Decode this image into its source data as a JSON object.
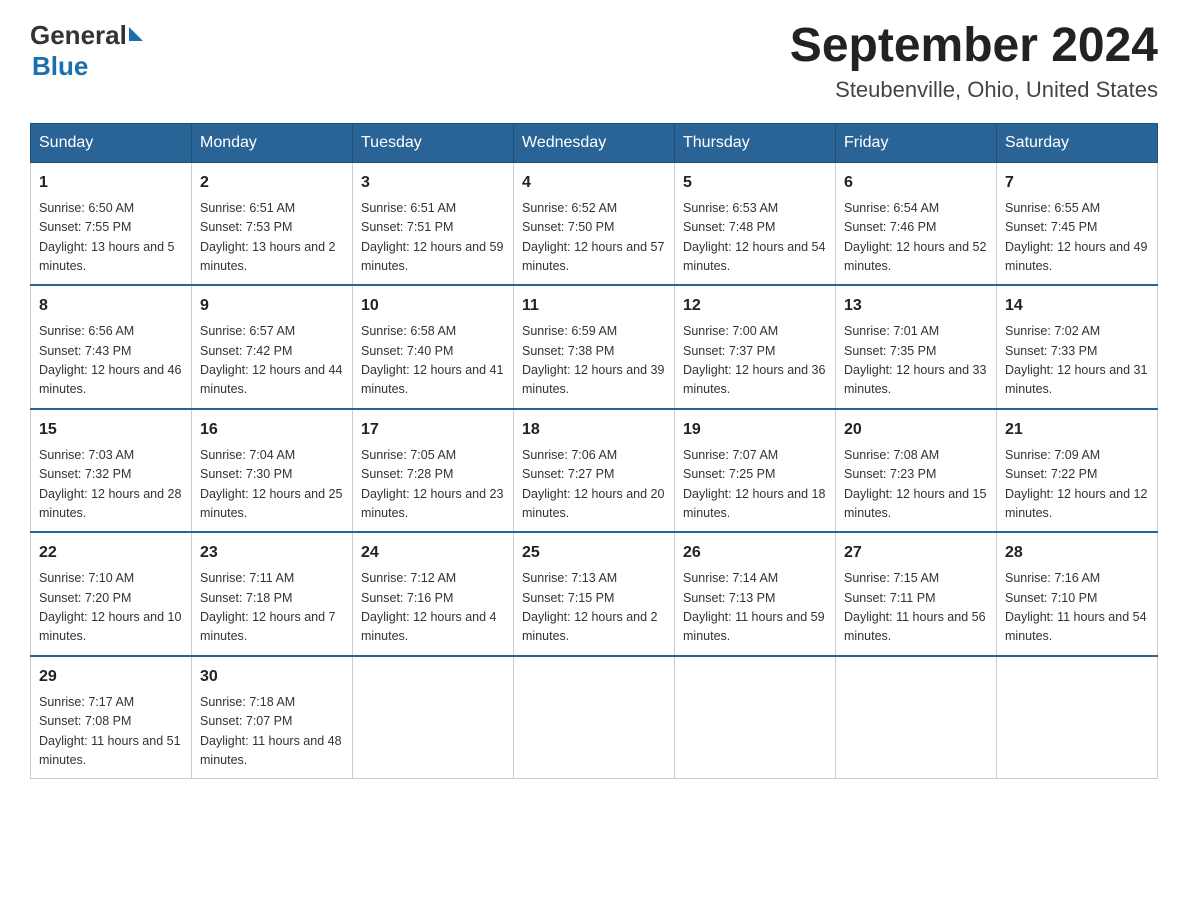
{
  "header": {
    "logo_general": "General",
    "logo_blue": "Blue",
    "month_title": "September 2024",
    "location": "Steubenville, Ohio, United States"
  },
  "days_of_week": [
    "Sunday",
    "Monday",
    "Tuesday",
    "Wednesday",
    "Thursday",
    "Friday",
    "Saturday"
  ],
  "weeks": [
    [
      {
        "date": "1",
        "sunrise": "6:50 AM",
        "sunset": "7:55 PM",
        "daylight": "13 hours and 5 minutes."
      },
      {
        "date": "2",
        "sunrise": "6:51 AM",
        "sunset": "7:53 PM",
        "daylight": "13 hours and 2 minutes."
      },
      {
        "date": "3",
        "sunrise": "6:51 AM",
        "sunset": "7:51 PM",
        "daylight": "12 hours and 59 minutes."
      },
      {
        "date": "4",
        "sunrise": "6:52 AM",
        "sunset": "7:50 PM",
        "daylight": "12 hours and 57 minutes."
      },
      {
        "date": "5",
        "sunrise": "6:53 AM",
        "sunset": "7:48 PM",
        "daylight": "12 hours and 54 minutes."
      },
      {
        "date": "6",
        "sunrise": "6:54 AM",
        "sunset": "7:46 PM",
        "daylight": "12 hours and 52 minutes."
      },
      {
        "date": "7",
        "sunrise": "6:55 AM",
        "sunset": "7:45 PM",
        "daylight": "12 hours and 49 minutes."
      }
    ],
    [
      {
        "date": "8",
        "sunrise": "6:56 AM",
        "sunset": "7:43 PM",
        "daylight": "12 hours and 46 minutes."
      },
      {
        "date": "9",
        "sunrise": "6:57 AM",
        "sunset": "7:42 PM",
        "daylight": "12 hours and 44 minutes."
      },
      {
        "date": "10",
        "sunrise": "6:58 AM",
        "sunset": "7:40 PM",
        "daylight": "12 hours and 41 minutes."
      },
      {
        "date": "11",
        "sunrise": "6:59 AM",
        "sunset": "7:38 PM",
        "daylight": "12 hours and 39 minutes."
      },
      {
        "date": "12",
        "sunrise": "7:00 AM",
        "sunset": "7:37 PM",
        "daylight": "12 hours and 36 minutes."
      },
      {
        "date": "13",
        "sunrise": "7:01 AM",
        "sunset": "7:35 PM",
        "daylight": "12 hours and 33 minutes."
      },
      {
        "date": "14",
        "sunrise": "7:02 AM",
        "sunset": "7:33 PM",
        "daylight": "12 hours and 31 minutes."
      }
    ],
    [
      {
        "date": "15",
        "sunrise": "7:03 AM",
        "sunset": "7:32 PM",
        "daylight": "12 hours and 28 minutes."
      },
      {
        "date": "16",
        "sunrise": "7:04 AM",
        "sunset": "7:30 PM",
        "daylight": "12 hours and 25 minutes."
      },
      {
        "date": "17",
        "sunrise": "7:05 AM",
        "sunset": "7:28 PM",
        "daylight": "12 hours and 23 minutes."
      },
      {
        "date": "18",
        "sunrise": "7:06 AM",
        "sunset": "7:27 PM",
        "daylight": "12 hours and 20 minutes."
      },
      {
        "date": "19",
        "sunrise": "7:07 AM",
        "sunset": "7:25 PM",
        "daylight": "12 hours and 18 minutes."
      },
      {
        "date": "20",
        "sunrise": "7:08 AM",
        "sunset": "7:23 PM",
        "daylight": "12 hours and 15 minutes."
      },
      {
        "date": "21",
        "sunrise": "7:09 AM",
        "sunset": "7:22 PM",
        "daylight": "12 hours and 12 minutes."
      }
    ],
    [
      {
        "date": "22",
        "sunrise": "7:10 AM",
        "sunset": "7:20 PM",
        "daylight": "12 hours and 10 minutes."
      },
      {
        "date": "23",
        "sunrise": "7:11 AM",
        "sunset": "7:18 PM",
        "daylight": "12 hours and 7 minutes."
      },
      {
        "date": "24",
        "sunrise": "7:12 AM",
        "sunset": "7:16 PM",
        "daylight": "12 hours and 4 minutes."
      },
      {
        "date": "25",
        "sunrise": "7:13 AM",
        "sunset": "7:15 PM",
        "daylight": "12 hours and 2 minutes."
      },
      {
        "date": "26",
        "sunrise": "7:14 AM",
        "sunset": "7:13 PM",
        "daylight": "11 hours and 59 minutes."
      },
      {
        "date": "27",
        "sunrise": "7:15 AM",
        "sunset": "7:11 PM",
        "daylight": "11 hours and 56 minutes."
      },
      {
        "date": "28",
        "sunrise": "7:16 AM",
        "sunset": "7:10 PM",
        "daylight": "11 hours and 54 minutes."
      }
    ],
    [
      {
        "date": "29",
        "sunrise": "7:17 AM",
        "sunset": "7:08 PM",
        "daylight": "11 hours and 51 minutes."
      },
      {
        "date": "30",
        "sunrise": "7:18 AM",
        "sunset": "7:07 PM",
        "daylight": "11 hours and 48 minutes."
      },
      null,
      null,
      null,
      null,
      null
    ]
  ]
}
